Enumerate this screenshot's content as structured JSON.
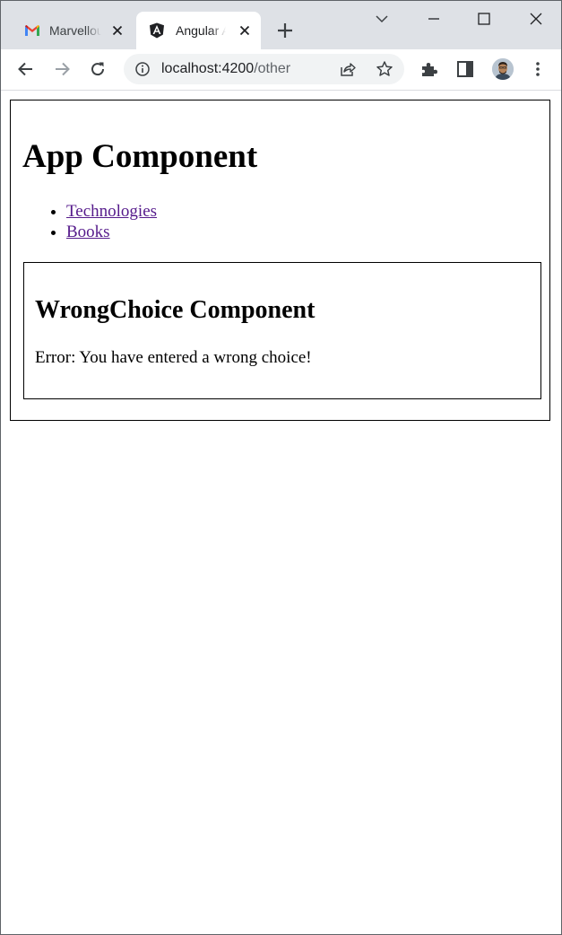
{
  "browser": {
    "tabs": [
      {
        "title": "Marvellous",
        "favicon": "gmail-icon",
        "active": false
      },
      {
        "title": "Angular App",
        "favicon": "angular-icon",
        "active": true
      }
    ],
    "address_bar": {
      "host": "localhost:4200",
      "path": "/other"
    }
  },
  "page": {
    "app_title": "App Component",
    "nav_links": [
      {
        "label": "Technologies"
      },
      {
        "label": "Books"
      }
    ],
    "child": {
      "title": "WrongChoice Component",
      "message": "Error: You have entered a wrong choice!"
    }
  },
  "colors": {
    "tabstrip": "#dee1e6",
    "link_visited": "#551a8b",
    "omnibox": "#f1f3f4"
  }
}
